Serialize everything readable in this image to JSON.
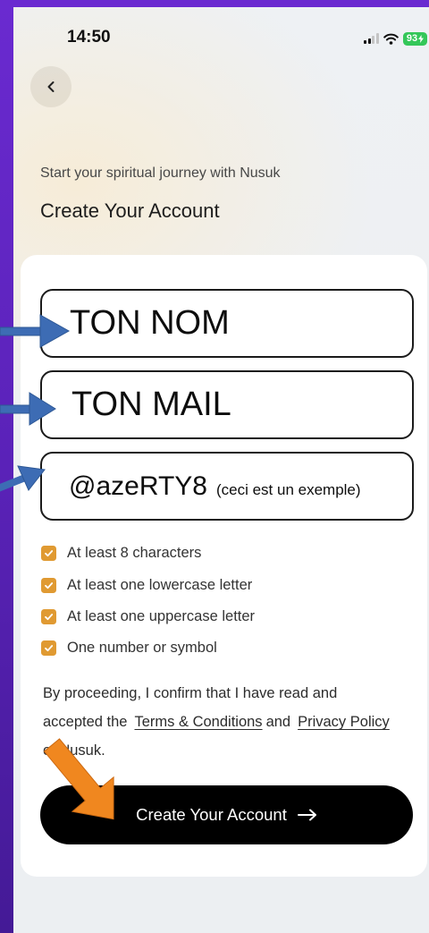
{
  "status_bar": {
    "time": "14:50",
    "battery_level": "93",
    "icons": [
      "signal-icon",
      "wifi-icon",
      "bolt-icon"
    ]
  },
  "header": {
    "back_icon": "chevron-left-icon",
    "subtitle": "Start your spiritual journey with Nusuk",
    "title": "Create Your Account"
  },
  "form": {
    "name_field": {
      "value": "TON NOM"
    },
    "email_field": {
      "value": "TON MAIL"
    },
    "password_field": {
      "value": "@azeRTY8",
      "note": "(ceci est un exemple)"
    }
  },
  "password_requirements": [
    {
      "label": "At least 8 characters",
      "met": true
    },
    {
      "label": "At least one lowercase letter",
      "met": true
    },
    {
      "label": "At least one uppercase letter",
      "met": true
    },
    {
      "label": "One number or symbol",
      "met": true
    }
  ],
  "consent": {
    "line1": "By proceeding, I confirm that I have read and",
    "line2_prefix": "accepted the",
    "terms_link": "Terms & Conditions",
    "conjunction": "and",
    "privacy_link": "Privacy Policy",
    "line3": "of Nusuk."
  },
  "submit_button": {
    "label": "Create Your Account",
    "icon": "arrow-right-icon"
  },
  "colors": {
    "frame": "#5a22b8",
    "checkbox": "#e09a32",
    "button": "#000000",
    "battery": "#34c759",
    "annotation_blue": "#3d6cb4",
    "annotation_orange": "#f0871f"
  }
}
